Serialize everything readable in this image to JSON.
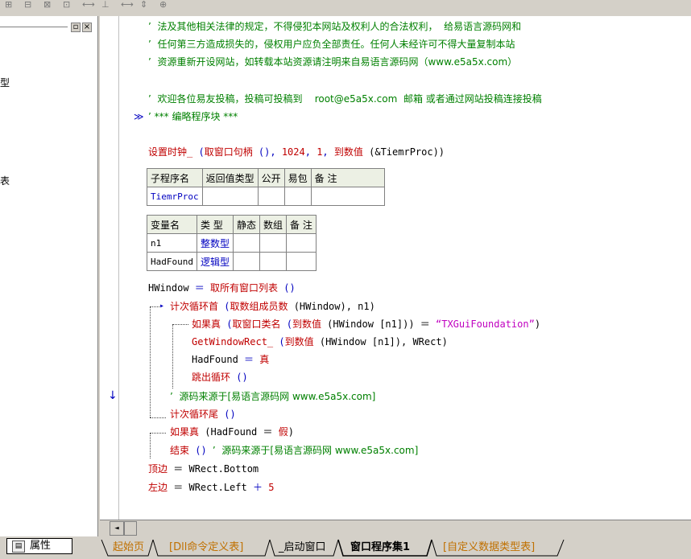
{
  "toolbar": {
    "icons": [
      "align-left-icon",
      "align-center-icon",
      "align-top-icon",
      "align-middle-icon",
      "space-horizontal-icon",
      "space-vertical-icon",
      "same-width-icon",
      "same-height-icon",
      "same-size-icon"
    ],
    "glyphs": [
      "⊞",
      "⊟",
      "⊠",
      "⊡",
      "⟷",
      "⊥",
      "⟷",
      "⇕",
      "⊕"
    ]
  },
  "left_panel": {
    "close_glyph": "×",
    "min_glyph": "▫",
    "frag1": "型",
    "frag2": "表",
    "properties_label": "属性"
  },
  "code": {
    "c1": "’  法及其他相关法律的规定，不得侵犯本网站及权利人的合法权利，  给易语言源码网和",
    "c2": "’  任何第三方造成损失的，侵权用户应负全部责任。任何人未经许可不得大量复制本站",
    "c3": "’  资源重新开设网站，如转载本站资源请注明来自易语言源码网（www.e5a5x.com）",
    "c4": "’  欢迎各位易友投稿，投稿可投稿到    root@e5a5x.com  邮箱 或者通过网站投稿连接投稿",
    "c5": "’ *** 编略程序块 ***",
    "c5_marker": "≫",
    "timer_line_a": "设置时钟_",
    "timer_line_b": " (",
    "timer_line_c": "取窗口句柄",
    "timer_line_d": " (), ",
    "timer_line_e": "1024",
    "timer_line_f": ", ",
    "timer_line_g": "1",
    "timer_line_h": ", ",
    "timer_line_i": "到数值",
    "timer_line_j": " (&TiemrProc))",
    "hwnd_a": "HWindow",
    "hwnd_b": " ＝ ",
    "hwnd_c": "取所有窗口列表",
    "hwnd_d": " ()",
    "loop_a": "计次循环首",
    "loop_b": " (",
    "loop_c": "取数组成员数",
    "loop_d": " (HWindow), n1)",
    "if_a": "如果真",
    "if_b": " (",
    "if_c": "取窗口类名",
    "if_d": " (",
    "if_e": "到数值",
    "if_f": " (HWindow [n1])) ＝ ",
    "if_g": "“TXGuiFoundation”",
    "if_h": ")",
    "getrect_a": "GetWindowRect_",
    "getrect_b": " (",
    "getrect_c": "到数值",
    "getrect_d": " (HWindow [n1]), WRect)",
    "found_a": "HadFound",
    "found_b": " ＝ ",
    "found_c": "真",
    "break_a": "跳出循环",
    "break_b": " ()",
    "src1_a": "’  源码来源于[易语言源码网 www.e5a5x.com]",
    "loopend_a": "计次循环尾",
    "loopend_b": " ()",
    "if2_a": "如果真",
    "if2_b": " (HadFound ＝ ",
    "if2_c": "假",
    "if2_d": ")",
    "end_a": "结束",
    "end_b": " () ",
    "end_c": "’  源码来源于[易语言源码网 www.e5a5x.com]",
    "top_a": "顶边",
    "top_b": " ＝ WRect.Bottom",
    "left_a": "左边",
    "left_b": " ＝ WRect.Left ",
    "left_c": "＋",
    "left_d": " ",
    "left_e": "5",
    "down_arrow": "↓",
    "loop_arrow": "▸"
  },
  "sub_table": {
    "headers": [
      "子程序名",
      "返回值类型",
      "公开",
      "易包",
      "备 注"
    ],
    "row": [
      "TiemrProc",
      "",
      "",
      "",
      ""
    ]
  },
  "var_table": {
    "headers": [
      "变量名",
      "类 型",
      "静态",
      "数组",
      "备 注"
    ],
    "rows": [
      [
        "n1",
        "整数型",
        "",
        "",
        ""
      ],
      [
        "HadFound",
        "逻辑型",
        "",
        "",
        ""
      ]
    ]
  },
  "scrollbar": {
    "left_glyph": "◄"
  },
  "tabs": [
    "起始页",
    "[Dll命令定义表]",
    "_启动窗口",
    "窗口程序集1",
    "[自定义数据类型表]"
  ],
  "active_tab": "窗口程序集1"
}
